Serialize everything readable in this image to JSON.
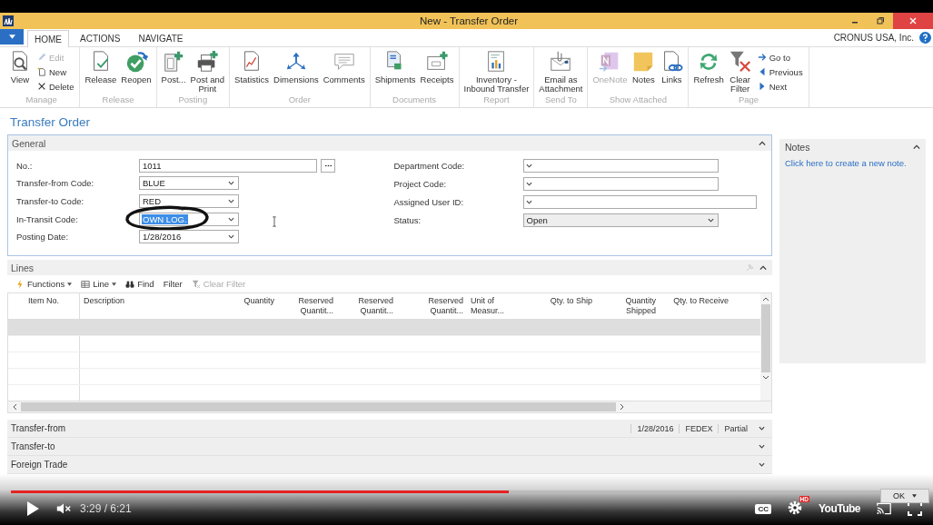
{
  "window": {
    "title": "New - Transfer Order",
    "company": "CRONUS USA, Inc."
  },
  "tabs": [
    {
      "label": "HOME",
      "selected": true
    },
    {
      "label": "ACTIONS",
      "selected": false
    },
    {
      "label": "NAVIGATE",
      "selected": false
    }
  ],
  "ribbon": [
    {
      "label": "Manage",
      "items": [
        {
          "label": "View",
          "kind": "large",
          "disabled": false
        },
        {
          "label": "Edit",
          "kind": "small",
          "disabled": true
        },
        {
          "label": "New",
          "kind": "small",
          "disabled": false
        },
        {
          "label": "Delete",
          "kind": "small",
          "disabled": false
        }
      ]
    },
    {
      "label": "Release",
      "items": [
        {
          "label": "Release",
          "kind": "large",
          "disabled": false
        },
        {
          "label": "Reopen",
          "kind": "large",
          "disabled": false
        }
      ]
    },
    {
      "label": "Posting",
      "items": [
        {
          "label": "Post...",
          "kind": "large",
          "disabled": false
        },
        {
          "label": "Post and\nPrint",
          "kind": "large",
          "disabled": false
        }
      ]
    },
    {
      "label": "Order",
      "items": [
        {
          "label": "Statistics",
          "kind": "large",
          "disabled": false
        },
        {
          "label": "Dimensions",
          "kind": "large",
          "disabled": false
        },
        {
          "label": "Comments",
          "kind": "large",
          "disabled": false
        }
      ]
    },
    {
      "label": "Documents",
      "items": [
        {
          "label": "Shipments",
          "kind": "large",
          "disabled": false
        },
        {
          "label": "Receipts",
          "kind": "large",
          "disabled": false
        }
      ]
    },
    {
      "label": "Report",
      "items": [
        {
          "label": "Inventory -\nInbound Transfer",
          "kind": "large",
          "disabled": false
        }
      ]
    },
    {
      "label": "Send To",
      "items": [
        {
          "label": "Email as\nAttachment",
          "kind": "large",
          "disabled": false
        }
      ]
    },
    {
      "label": "Show Attached",
      "items": [
        {
          "label": "OneNote",
          "kind": "large",
          "disabled": true
        },
        {
          "label": "Notes",
          "kind": "large",
          "disabled": false
        },
        {
          "label": "Links",
          "kind": "large",
          "disabled": false
        }
      ]
    },
    {
      "label": "Page",
      "items": [
        {
          "label": "Refresh",
          "kind": "large",
          "disabled": false
        },
        {
          "label": "Clear\nFilter",
          "kind": "large",
          "disabled": false
        },
        {
          "label": "Go to",
          "kind": "small",
          "disabled": false
        },
        {
          "label": "Previous",
          "kind": "small",
          "disabled": false
        },
        {
          "label": "Next",
          "kind": "small",
          "disabled": false
        }
      ]
    }
  ],
  "page_title": "Transfer Order",
  "general": {
    "title": "General",
    "left": [
      {
        "label": "No.:",
        "value": "1011",
        "kind": "lookup",
        "disabled": false,
        "highlighted": false,
        "circled": false
      },
      {
        "label": "Transfer-from Code:",
        "value": "BLUE",
        "kind": "dropdown",
        "disabled": false,
        "highlighted": false,
        "circled": false
      },
      {
        "label": "Transfer-to Code:",
        "value": "RED",
        "kind": "dropdown",
        "disabled": false,
        "highlighted": false,
        "circled": false
      },
      {
        "label": "In-Transit Code:",
        "value": "OWN LOG.",
        "kind": "dropdown",
        "disabled": false,
        "highlighted": true,
        "circled": true
      },
      {
        "label": "Posting Date:",
        "value": "1/28/2016",
        "kind": "dropdown",
        "disabled": false,
        "highlighted": false,
        "circled": false
      }
    ],
    "right": [
      {
        "label": "Department Code:",
        "kind": "dropdown",
        "disabled": false,
        "wide": false
      },
      {
        "label": "Project Code:",
        "kind": "dropdown",
        "disabled": false,
        "wide": false
      },
      {
        "label": "Assigned User ID:",
        "kind": "dropdown",
        "disabled": false,
        "wide": true
      },
      {
        "label": "Status:",
        "value": "Open",
        "kind": "dropdown",
        "disabled": true,
        "wide": false
      }
    ]
  },
  "notes": {
    "title": "Notes",
    "link": "Click here to create a new note."
  },
  "lines": {
    "title": "Lines",
    "toolbar": [
      {
        "label": "Functions",
        "kind": "menu",
        "disabled": false
      },
      {
        "label": "Line",
        "kind": "menu",
        "disabled": false
      },
      {
        "label": "Find",
        "kind": "button",
        "disabled": false
      },
      {
        "label": "Filter",
        "kind": "button",
        "disabled": false
      },
      {
        "label": "Clear Filter",
        "kind": "button",
        "disabled": true
      }
    ],
    "columns": [
      {
        "label": "Item No."
      },
      {
        "label": "Description"
      },
      {
        "label": "Quantity"
      },
      {
        "label": "Reserved\nQuantit..."
      },
      {
        "label": "Reserved\nQuantit..."
      },
      {
        "label": "Reserved\nQuantit..."
      },
      {
        "label": "Unit of\nMeasur..."
      },
      {
        "label": "Qty. to Ship"
      },
      {
        "label": "Quantity\nShipped"
      },
      {
        "label": "Qty. to Receive"
      }
    ],
    "rows": [
      {
        "selected": true
      },
      {
        "selected": false
      },
      {
        "selected": false
      },
      {
        "selected": false
      },
      {
        "selected": false
      }
    ]
  },
  "fasttabs": [
    {
      "label": "Transfer-from",
      "summary": [
        "1/28/2016",
        "FEDEX",
        "Partial"
      ]
    },
    {
      "label": "Transfer-to"
    },
    {
      "label": "Foreign Trade"
    }
  ],
  "player": {
    "level": 0.546,
    "muted": true,
    "time": "3:29 / 6:21",
    "cc": "CC",
    "hd": "HD",
    "logo": "YouTube",
    "quality": "OK"
  }
}
